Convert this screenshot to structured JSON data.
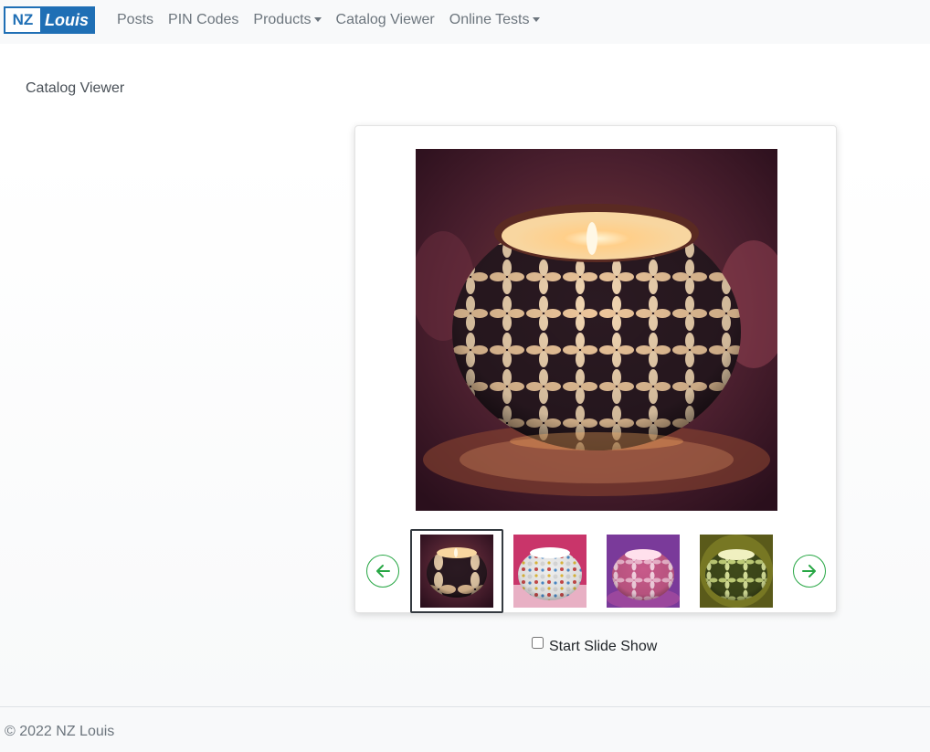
{
  "brand": {
    "part1": "NZ",
    "part2": "Louis",
    "accent": "#1f6fb5"
  },
  "nav": {
    "items": [
      {
        "label": "Posts",
        "dropdown": false
      },
      {
        "label": "PIN Codes",
        "dropdown": false
      },
      {
        "label": "Products",
        "dropdown": true
      },
      {
        "label": "Catalog Viewer",
        "dropdown": false
      },
      {
        "label": "Online Tests",
        "dropdown": true
      }
    ]
  },
  "page": {
    "title": "Catalog Viewer"
  },
  "viewer": {
    "main_image": "mosaic-candle-holder-brown",
    "prev_icon": "arrow-left-icon",
    "next_icon": "arrow-right-icon",
    "button_color": "#28a745",
    "thumbnails": [
      {
        "name": "mosaic-candle-holder-brown",
        "active": true
      },
      {
        "name": "mosaic-candle-holder-white-multicolor",
        "active": false
      },
      {
        "name": "mosaic-candle-holder-pink",
        "active": false
      },
      {
        "name": "mosaic-candle-holder-green",
        "active": false
      }
    ],
    "slideshow_label": "Start Slide Show",
    "slideshow_checked": false
  },
  "footer": {
    "text": "© 2022 NZ Louis"
  }
}
